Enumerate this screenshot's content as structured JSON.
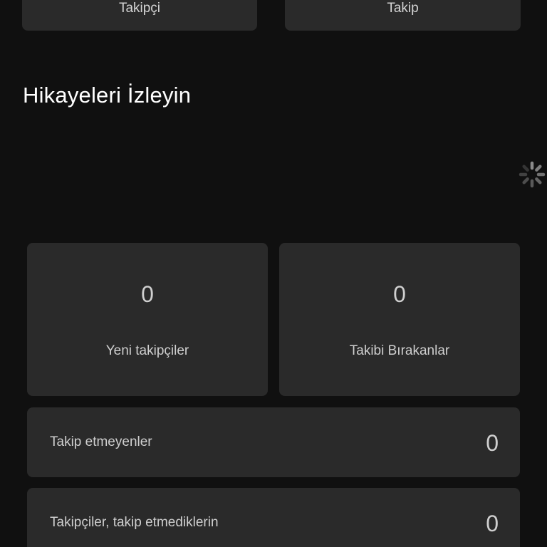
{
  "top_stats": {
    "followers_label": "Takipçi",
    "following_label": "Takip"
  },
  "stories": {
    "title": "Hikayeleri İzleyin",
    "loading_icon": "spinner-icon"
  },
  "stats": {
    "new_followers": {
      "value": "0",
      "label": "Yeni takipçiler"
    },
    "unfollowers": {
      "value": "0",
      "label": "Takibi Bırakanlar"
    }
  },
  "rows": {
    "not_following_back": {
      "label": "Takip etmeyenler",
      "value": "0"
    },
    "not_followed": {
      "label": "Takipçiler, takip etmediklerin",
      "value": "0"
    }
  },
  "colors": {
    "background": "#101010",
    "card": "#2a2a2a",
    "text": "#cfcfcf",
    "title": "#ffffff"
  }
}
